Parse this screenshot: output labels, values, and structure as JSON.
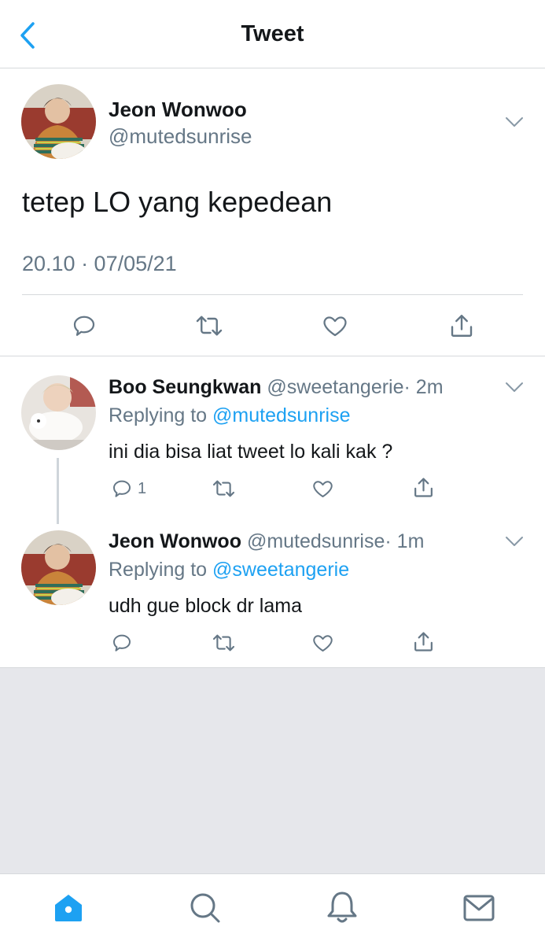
{
  "colors": {
    "accent": "#1da1f2",
    "text": "#14171a",
    "secondary": "#657786",
    "divider": "#d6d9dc",
    "empty_area": "#e6e7eb"
  },
  "header": {
    "title": "Tweet",
    "back_icon": "chevron-left-icon"
  },
  "main_tweet": {
    "display_name": "Jeon Wonwoo",
    "handle": "@mutedsunrise",
    "text": "tetep LO yang kepedean",
    "timestamp": "20.10 · 07/05/21",
    "actions": [
      "reply-icon",
      "retweet-icon",
      "like-icon",
      "share-icon"
    ]
  },
  "replies": [
    {
      "display_name": "Boo Seungkwan",
      "handle": "@sweetangerie",
      "time": "· 2m",
      "replying_prefix": "Replying to ",
      "replying_to": "@mutedsunrise",
      "text": "ini dia bisa liat tweet lo kali kak ?",
      "reply_count": "1"
    },
    {
      "display_name": "Jeon Wonwoo",
      "handle": "@mutedsunrise",
      "time": "· 1m",
      "replying_prefix": "Replying to ",
      "replying_to": "@sweetangerie",
      "text": "udh gue block dr lama",
      "reply_count": ""
    }
  ],
  "tabbar": {
    "tabs": [
      "home-icon",
      "search-icon",
      "notifications-icon",
      "messages-icon"
    ],
    "active": "home-icon"
  }
}
